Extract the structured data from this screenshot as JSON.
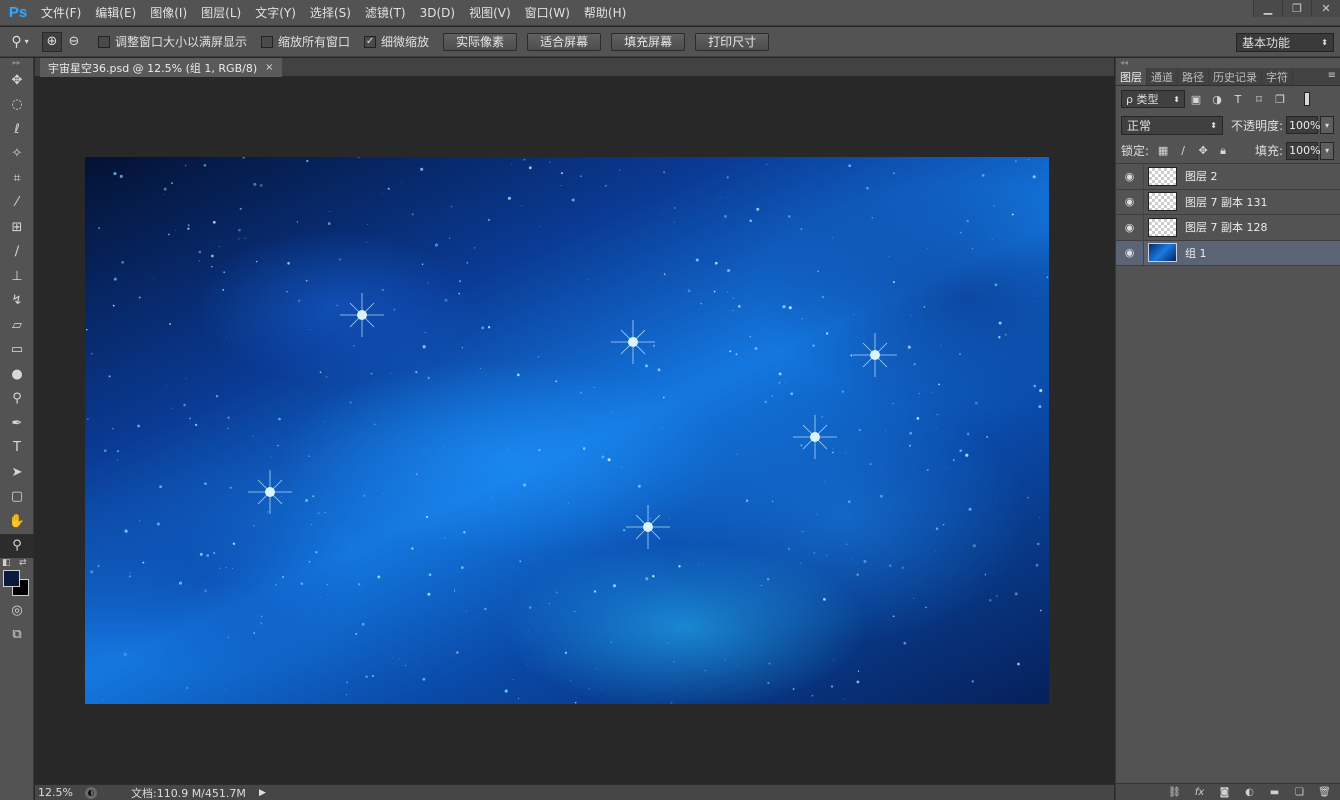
{
  "app": {
    "logo": "Ps",
    "menus": [
      "文件(F)",
      "编辑(E)",
      "图像(I)",
      "图层(L)",
      "文字(Y)",
      "选择(S)",
      "滤镜(T)",
      "3D(D)",
      "视图(V)",
      "窗口(W)",
      "帮助(H)"
    ],
    "window_controls": [
      "minimize-icon",
      "restore-icon",
      "close-icon"
    ]
  },
  "options_bar": {
    "tool_icon": "zoom-tool-icon",
    "zoom_in_icon": "zoom-in-icon",
    "zoom_out_icon": "zoom-out-icon",
    "checkboxes": [
      {
        "label": "调整窗口大小以满屏显示",
        "checked": false
      },
      {
        "label": "缩放所有窗口",
        "checked": false
      },
      {
        "label": "细微缩放",
        "checked": true
      }
    ],
    "buttons": [
      "实际像素",
      "适合屏幕",
      "填充屏幕",
      "打印尺寸"
    ],
    "workspace": "基本功能"
  },
  "toolbox": {
    "tools": [
      "move-tool-icon",
      "marquee-tool-icon",
      "lasso-tool-icon",
      "magic-wand-tool-icon",
      "crop-tool-icon",
      "eyedropper-tool-icon",
      "healing-brush-tool-icon",
      "brush-tool-icon",
      "clone-stamp-tool-icon",
      "history-brush-tool-icon",
      "eraser-tool-icon",
      "gradient-tool-icon",
      "blur-tool-icon",
      "dodge-tool-icon",
      "pen-tool-icon",
      "type-tool-icon",
      "path-selection-tool-icon",
      "rectangle-tool-icon",
      "hand-tool-icon",
      "zoom-tool-icon"
    ],
    "active_tool": "zoom-tool-icon",
    "foreground_color": "#0a1a3c",
    "background_color": "#000000"
  },
  "document": {
    "tab_title": "宇宙星空36.psd @ 12.5% (组 1, RGB/8)",
    "close_symbol": "×"
  },
  "status_bar": {
    "zoom": "12.5%",
    "doc_size": "文档:110.9 M/451.7M"
  },
  "layers_panel": {
    "tabs": [
      "图层",
      "通道",
      "路径",
      "历史记录",
      "字符"
    ],
    "active_tab": "图层",
    "filter_kind": "ρ 类型",
    "blend_mode": "正常",
    "opacity_label": "不透明度:",
    "opacity": "100%",
    "lock_label": "锁定:",
    "fill_label": "填充:",
    "fill": "100%",
    "layers": [
      {
        "name": "图层 2",
        "type": "layer",
        "visible": true,
        "selected": false
      },
      {
        "name": "图层 7 副本 131",
        "type": "layer",
        "visible": true,
        "selected": false
      },
      {
        "name": "图层 7 副本 128",
        "type": "layer",
        "visible": true,
        "selected": false
      },
      {
        "name": "组 1",
        "type": "group",
        "visible": true,
        "selected": true
      }
    ],
    "footer_icons": [
      "link-icon",
      "fx-icon",
      "mask-icon",
      "adjustment-icon",
      "folder-icon",
      "new-layer-icon",
      "trash-icon"
    ]
  },
  "theme": {
    "accent": "#31a8ff",
    "selected_layer": "#5a6474"
  }
}
